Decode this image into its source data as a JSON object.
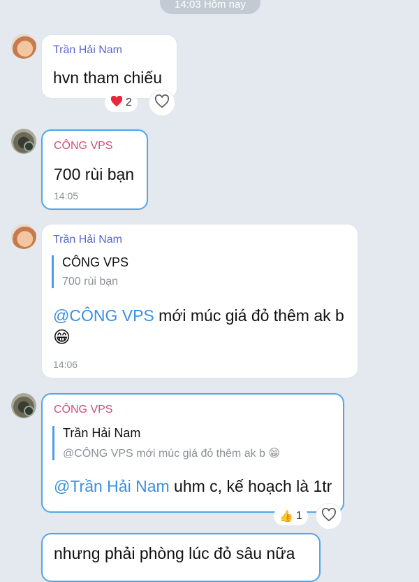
{
  "date_pill": "14:03 Hôm nay",
  "messages": [
    {
      "sender": "Trần Hải Nam",
      "text": "hvn tham chiếu",
      "reaction_count": "2",
      "reaction_icon": "heart"
    },
    {
      "sender": "CÔNG VPS",
      "text": "700 rùi bạn",
      "time": "14:05"
    },
    {
      "sender": "Trần Hải Nam",
      "quote_name": "CÔNG VPS",
      "quote_text": "700 rùi bạn",
      "mention": "@CÔNG VPS",
      "text": " mới múc giá đỏ thêm ak b",
      "emoji": "😁",
      "time": "14:06"
    },
    {
      "sender": "CÔNG VPS",
      "quote_name": "Trần Hải Nam",
      "quote_text": "@CÔNG VPS mới múc giá đỏ thêm ak b 😁",
      "mention": "@Trần Hải Nam",
      "text": " uhm c, kế hoạch là 1tr",
      "reaction_emoji": "👍",
      "reaction_count": "1"
    },
    {
      "text": "nhưng phải phòng lúc đỏ sâu nữa"
    }
  ]
}
